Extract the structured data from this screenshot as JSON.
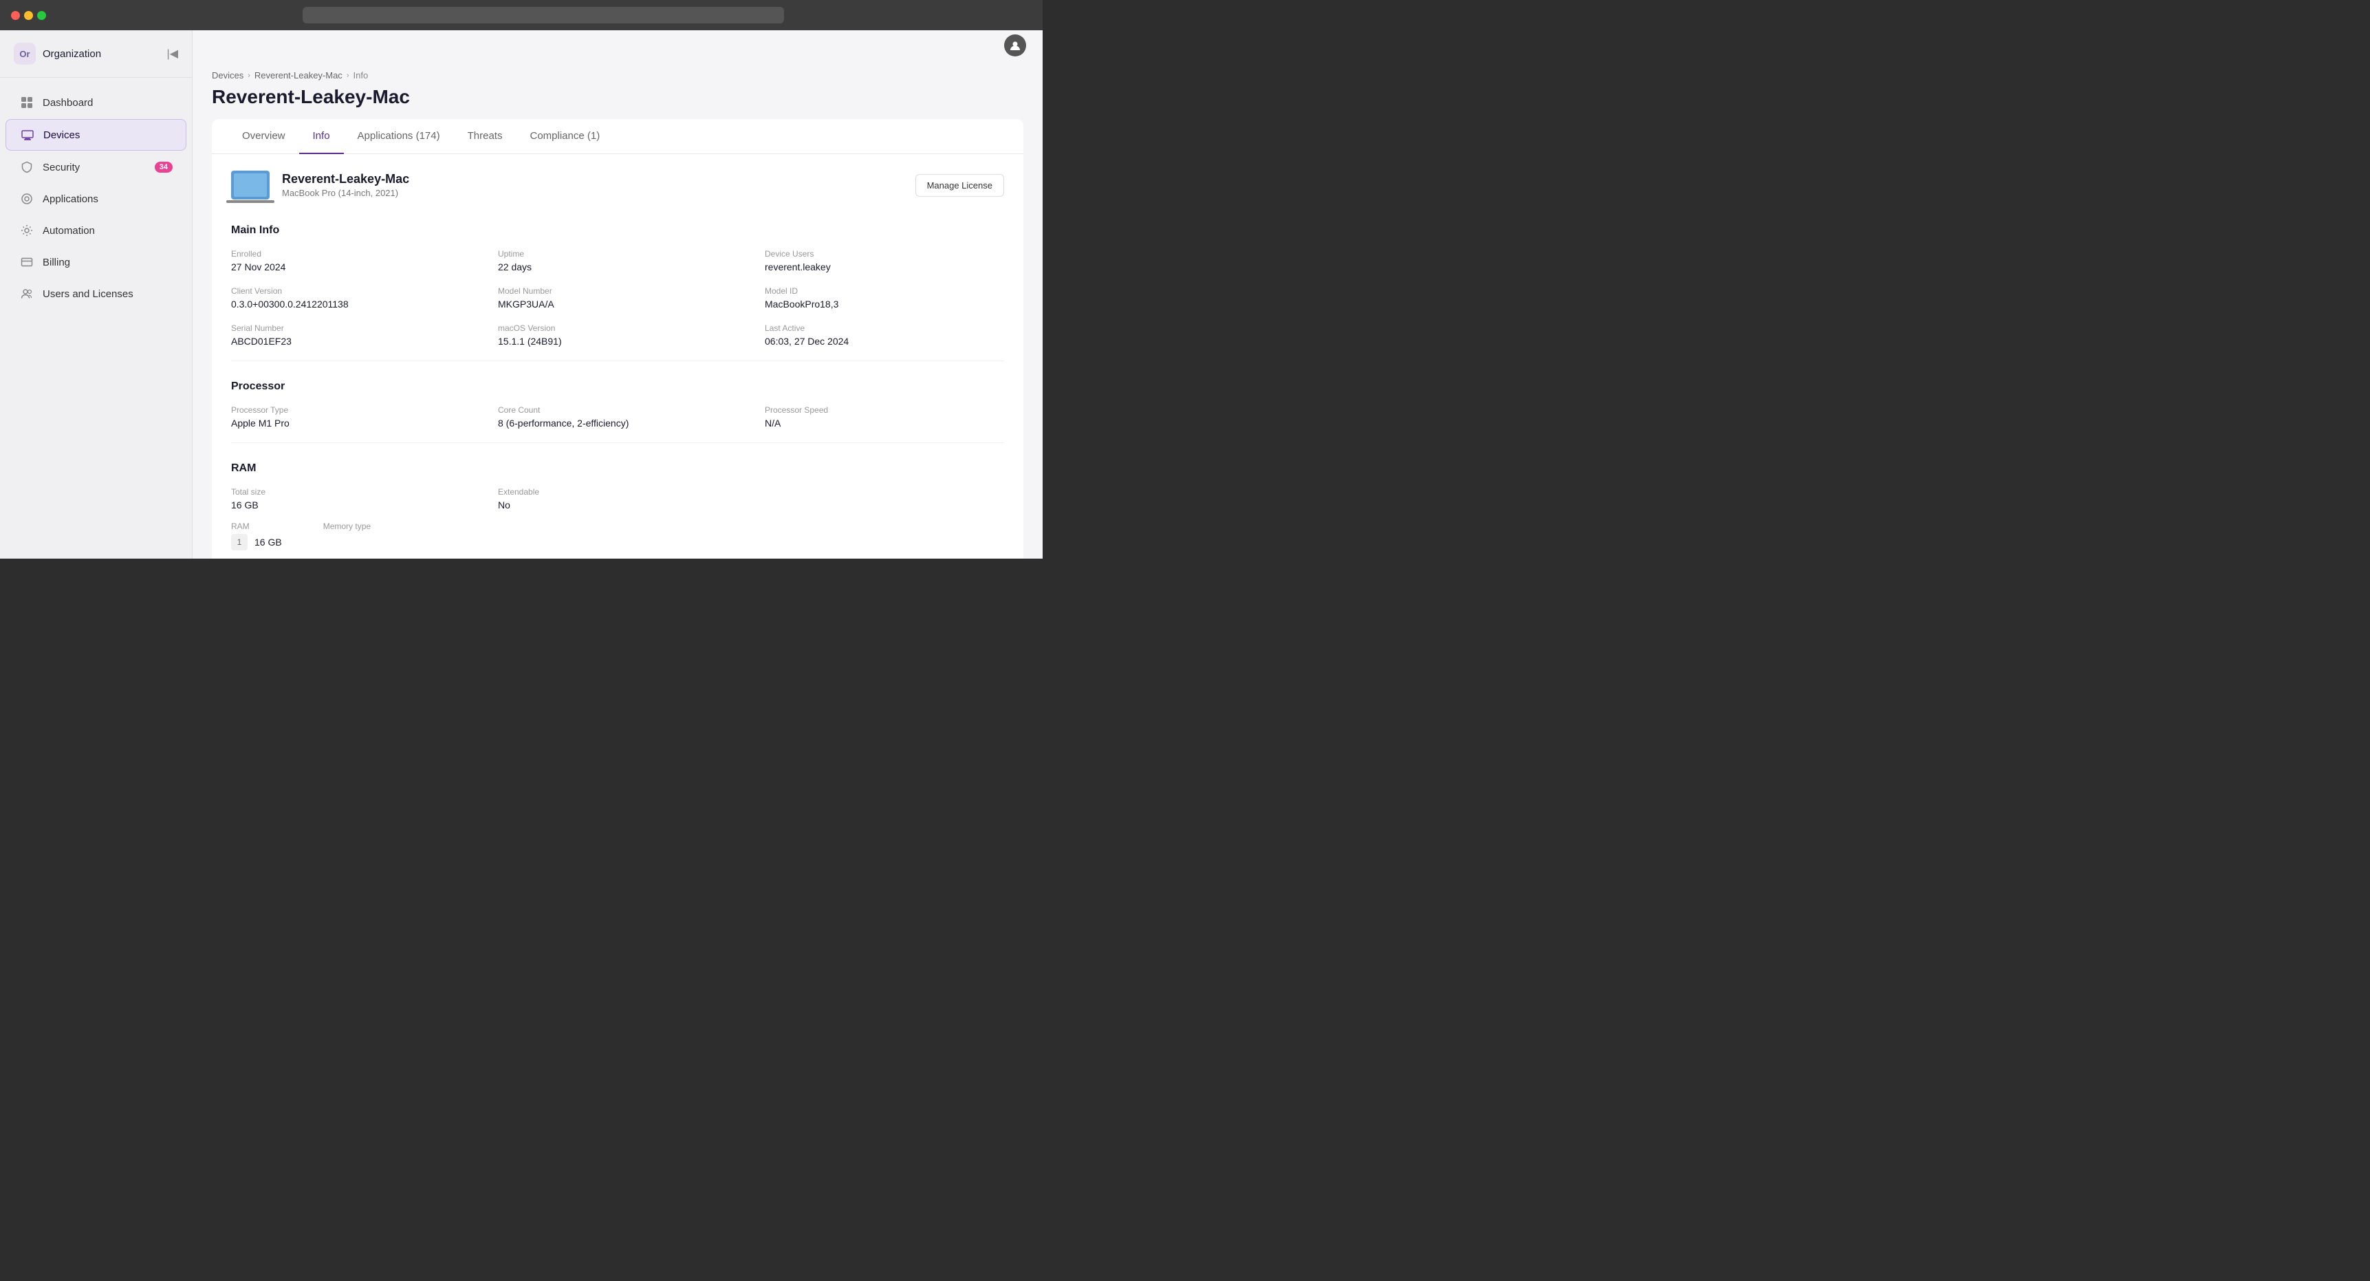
{
  "browser": {
    "address": ""
  },
  "sidebar": {
    "org_avatar": "Or",
    "org_name": "Organization",
    "collapse_icon": "◀",
    "items": [
      {
        "id": "dashboard",
        "label": "Dashboard",
        "icon": "dashboard",
        "active": false,
        "badge": null
      },
      {
        "id": "devices",
        "label": "Devices",
        "icon": "devices",
        "active": true,
        "badge": null
      },
      {
        "id": "security",
        "label": "Security",
        "icon": "security",
        "active": false,
        "badge": "34"
      },
      {
        "id": "applications",
        "label": "Applications",
        "icon": "applications",
        "active": false,
        "badge": null
      },
      {
        "id": "automation",
        "label": "Automation",
        "icon": "automation",
        "active": false,
        "badge": null
      },
      {
        "id": "billing",
        "label": "Billing",
        "icon": "billing",
        "active": false,
        "badge": null
      },
      {
        "id": "users-licenses",
        "label": "Users and Licenses",
        "icon": "users",
        "active": false,
        "badge": null
      }
    ]
  },
  "header": {
    "user_icon": "👤"
  },
  "breadcrumb": {
    "items": [
      "Devices",
      "Reverent-Leakey-Mac",
      "Info"
    ]
  },
  "page": {
    "title": "Reverent-Leakey-Mac"
  },
  "tabs": [
    {
      "id": "overview",
      "label": "Overview",
      "active": false
    },
    {
      "id": "info",
      "label": "Info",
      "active": true
    },
    {
      "id": "applications",
      "label": "Applications (174)",
      "active": false
    },
    {
      "id": "threats",
      "label": "Threats",
      "active": false
    },
    {
      "id": "compliance",
      "label": "Compliance (1)",
      "active": false
    }
  ],
  "device": {
    "name": "Reverent-Leakey-Mac",
    "model": "MacBook Pro (14-inch, 2021)",
    "manage_license_btn": "Manage License"
  },
  "main_info": {
    "section_title": "Main Info",
    "enrolled_label": "Enrolled",
    "enrolled_value": "27 Nov 2024",
    "uptime_label": "Uptime",
    "uptime_value": "22 days",
    "device_users_label": "Device Users",
    "device_users_value": "reverent.leakey",
    "client_version_label": "Client Version",
    "client_version_value": "0.3.0+00300.0.2412201138",
    "model_number_label": "Model Number",
    "model_number_value": "MKGP3UA/A",
    "model_id_label": "Model ID",
    "model_id_value": "MacBookPro18,3",
    "serial_number_label": "Serial Number",
    "serial_number_value": "ABCD01EF23",
    "macos_version_label": "macOS Version",
    "macos_version_value": "15.1.1 (24B91)",
    "last_active_label": "Last Active",
    "last_active_value": "06:03, 27 Dec 2024"
  },
  "processor": {
    "section_title": "Processor",
    "type_label": "Processor Type",
    "type_value": "Apple M1 Pro",
    "core_count_label": "Core Count",
    "core_count_value": "8 (6-performance, 2-efficiency)",
    "speed_label": "Processor Speed",
    "speed_value": "N/A"
  },
  "ram": {
    "section_title": "RAM",
    "total_size_label": "Total size",
    "total_size_value": "16 GB",
    "extendable_label": "Extendable",
    "extendable_value": "No",
    "slot_label": "RAM",
    "slot_value": "16 GB",
    "memory_type_label": "Memory type",
    "slot_number": "1"
  }
}
